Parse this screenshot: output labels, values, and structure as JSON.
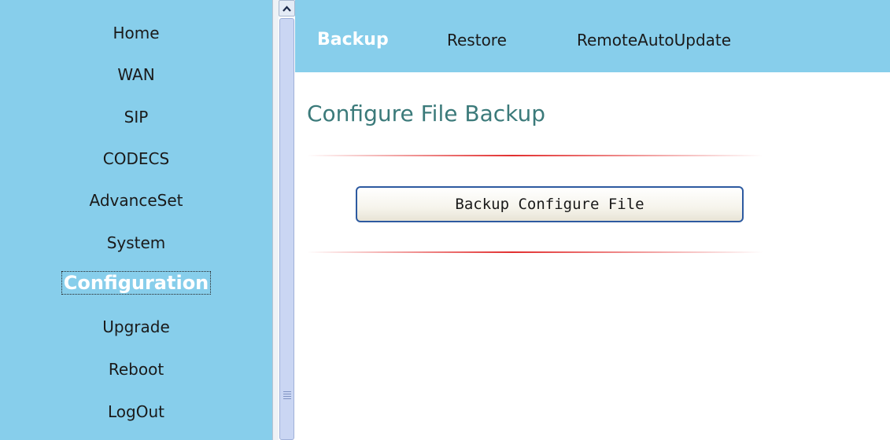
{
  "sidebar": {
    "items": [
      {
        "label": "Home"
      },
      {
        "label": "WAN"
      },
      {
        "label": "SIP"
      },
      {
        "label": "CODECS"
      },
      {
        "label": "AdvanceSet"
      },
      {
        "label": "System"
      },
      {
        "label": "Configuration",
        "active": true
      },
      {
        "label": "Upgrade"
      },
      {
        "label": "Reboot"
      },
      {
        "label": "LogOut"
      }
    ]
  },
  "tabs": [
    {
      "label": "Backup",
      "active": true
    },
    {
      "label": "Restore"
    },
    {
      "label": "RemoteAutoUpdate"
    }
  ],
  "main": {
    "title": "Configure File Backup",
    "backup_button": "Backup Configure File"
  },
  "colors": {
    "nav_background": "#87ceeb",
    "title_color": "#3b7a7a",
    "divider_red": "#e23030",
    "button_border": "#2d5aa0"
  },
  "icons": {
    "scroll_up": "chevron-up-icon",
    "scroll_grip": "grip-icon"
  }
}
